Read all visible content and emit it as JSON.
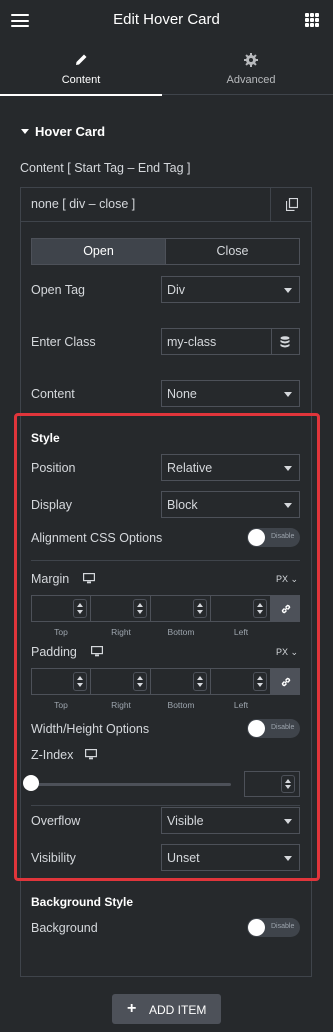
{
  "header": {
    "title": "Edit Hover Card"
  },
  "tabs": [
    {
      "label": "Content",
      "icon": "pencil-icon"
    },
    {
      "label": "Advanced",
      "icon": "gear-icon"
    }
  ],
  "section": {
    "title": "Hover Card"
  },
  "repeater": {
    "label": "Content [ Start Tag – End Tag ]",
    "item_title": "none [ div – close ]"
  },
  "open_close": {
    "open": "Open",
    "close": "Close"
  },
  "fields": {
    "open_tag": {
      "label": "Open Tag",
      "value": "Div"
    },
    "enter_class": {
      "label": "Enter Class",
      "value": "my-class"
    },
    "content": {
      "label": "Content",
      "value": "None"
    }
  },
  "style": {
    "title": "Style",
    "position": {
      "label": "Position",
      "value": "Relative"
    },
    "display": {
      "label": "Display",
      "value": "Block"
    },
    "alignment": {
      "label": "Alignment CSS Options",
      "toggle": "Disable"
    },
    "margin": {
      "label": "Margin",
      "unit": "PX",
      "sides": [
        "Top",
        "Right",
        "Bottom",
        "Left"
      ]
    },
    "padding": {
      "label": "Padding",
      "unit": "PX",
      "sides": [
        "Top",
        "Right",
        "Bottom",
        "Left"
      ]
    },
    "width_height": {
      "label": "Width/Height Options",
      "toggle": "Disable"
    },
    "zindex": {
      "label": "Z-Index"
    },
    "overflow": {
      "label": "Overflow",
      "value": "Visible"
    },
    "visibility": {
      "label": "Visibility",
      "value": "Unset"
    }
  },
  "background": {
    "title": "Background Style",
    "label": "Background",
    "toggle": "Disable"
  },
  "add_item": "ADD ITEM",
  "colors": {
    "highlight": "#e0353b",
    "bg": "#26292c",
    "border": "#4d5159"
  }
}
